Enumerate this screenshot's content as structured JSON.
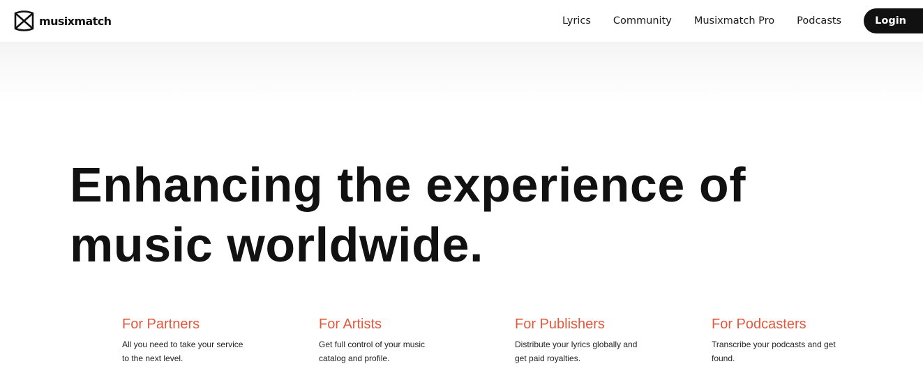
{
  "brand": {
    "name": "musixmatch",
    "logo_icon": "musixmatch-logo-icon",
    "text_color": "#111111"
  },
  "nav": {
    "items": [
      {
        "label": "Lyrics"
      },
      {
        "label": "Community"
      },
      {
        "label": "Musixmatch Pro"
      },
      {
        "label": "Podcasts"
      }
    ],
    "login_label": "Login",
    "login_bg": "#111111"
  },
  "hero": {
    "line1": "Enhancing the experience of",
    "line2": "music worldwide."
  },
  "features": {
    "accent_color": "#e4583e",
    "items": [
      {
        "title": "For Partners",
        "description": "All you need to take your service to the next level."
      },
      {
        "title": "For Artists",
        "description": "Get full control of your music catalog and profile."
      },
      {
        "title": "For Publishers",
        "description": "Distribute your lyrics globally and get paid royalties."
      },
      {
        "title": "For Podcasters",
        "description": "Transcribe your podcasts and get found."
      }
    ]
  }
}
